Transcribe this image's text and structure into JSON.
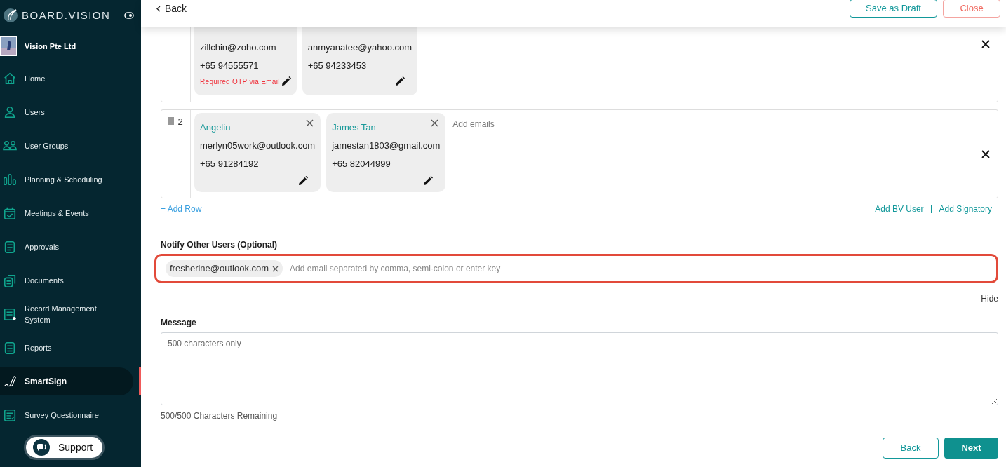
{
  "sidebar": {
    "brand": "BOARD.VISION",
    "organization": "Vision Pte Ltd",
    "items": [
      {
        "label": "Home",
        "selected": false
      },
      {
        "label": "Users",
        "selected": false
      },
      {
        "label": "User Groups",
        "selected": false
      },
      {
        "label": "Planning & Scheduling",
        "selected": false
      },
      {
        "label": "Meetings & Events",
        "selected": false
      },
      {
        "label": "Approvals",
        "selected": false
      },
      {
        "label": "Documents",
        "selected": false
      },
      {
        "label": "Record Management System",
        "selected": false
      },
      {
        "label": "Reports",
        "selected": false
      },
      {
        "label": "SmartSign",
        "selected": true
      },
      {
        "label": "Survey Questionnaire",
        "selected": false
      }
    ],
    "support": "Support"
  },
  "header": {
    "back": "Back",
    "save_draft": "Save as Draft",
    "close": "Close"
  },
  "signer_rows": [
    {
      "signers": [
        {
          "email": "zillchin@zoho.com",
          "phone": "+65 94555571",
          "note": "Required OTP via Email"
        },
        {
          "email": "anmyanatee@yahoo.com",
          "phone": "+65 94233453"
        }
      ]
    },
    {
      "number": "2",
      "placeholder": "Add emails",
      "signers": [
        {
          "name": "Angelin",
          "email": "merlyn05work@outlook.com",
          "phone": "+65 91284192"
        },
        {
          "name": "James Tan",
          "email": "jamestan1803@gmail.com",
          "phone": "+65 82044999"
        }
      ]
    }
  ],
  "add_row": "+ Add Row",
  "add_bv_user": "Add BV User",
  "add_signatory": "Add Signatory",
  "notify": {
    "label": "Notify Other Users (Optional)",
    "chips": [
      "fresherine@outlook.com"
    ],
    "placeholder": "Add email separated by comma, semi-colon or enter key",
    "hide": "Hide"
  },
  "message": {
    "label": "Message",
    "placeholder": "500 characters only",
    "remaining": "500/500 Characters Remaining"
  },
  "footer": {
    "back": "Back",
    "next": "Next"
  }
}
